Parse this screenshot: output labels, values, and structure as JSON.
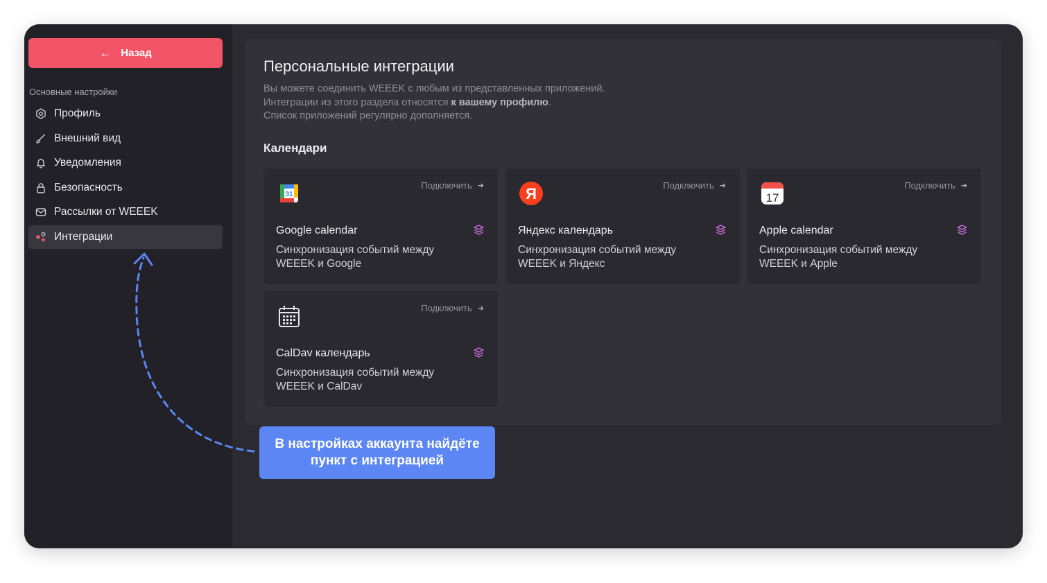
{
  "sidebar": {
    "back_label": "Назад",
    "section_label": "Основные настройки",
    "items": [
      {
        "label": "Профиль",
        "icon": "profile-gear-icon"
      },
      {
        "label": "Внешний вид",
        "icon": "brush-icon"
      },
      {
        "label": "Уведомления",
        "icon": "bell-icon"
      },
      {
        "label": "Безопасность",
        "icon": "lock-icon"
      },
      {
        "label": "Рассылки от WEEEK",
        "icon": "mail-icon"
      },
      {
        "label": "Интеграции",
        "icon": "integrations-icon",
        "active": true
      }
    ]
  },
  "main": {
    "title": "Персональные интеграции",
    "desc_line1": "Вы можете соединить WEEEK с любым из представленных приложений.",
    "desc_line2_prefix": "Интеграции из этого раздела относятся",
    "desc_line2_bold": "к вашему профилю",
    "desc_line2_suffix": ".",
    "desc_line3": "Список приложений регулярно дополняется.",
    "calendars_title": "Календари",
    "cards": [
      {
        "name": "Google calendar",
        "connect": "Подключить",
        "desc": "Синхронизация событий между WEEEK и Google",
        "icon": "google-calendar-icon"
      },
      {
        "name": "Яндекс календарь",
        "connect": "Подключить",
        "desc": "Синхронизация событий между WEEEK и Яндекс",
        "icon": "yandex-icon"
      },
      {
        "name": "Apple calendar",
        "connect": "Подключить",
        "desc": "Синхронизация событий между WEEEK и Apple",
        "icon": "apple-calendar-icon"
      },
      {
        "name": "CalDav календарь",
        "connect": "Подключить",
        "desc": "Синхронизация событий между WEEEK и CalDav",
        "icon": "caldav-icon"
      }
    ],
    "google_icon_text": "31",
    "apple_icon_text": "17",
    "yandex_icon_text": "Я"
  },
  "callout": {
    "line1": "В настройках аккаунта найдёте",
    "line2": "пункт с интеграцией"
  },
  "colors": {
    "accent": "#f25467",
    "callout": "#5b86f3",
    "tag": "#c66bd7"
  }
}
